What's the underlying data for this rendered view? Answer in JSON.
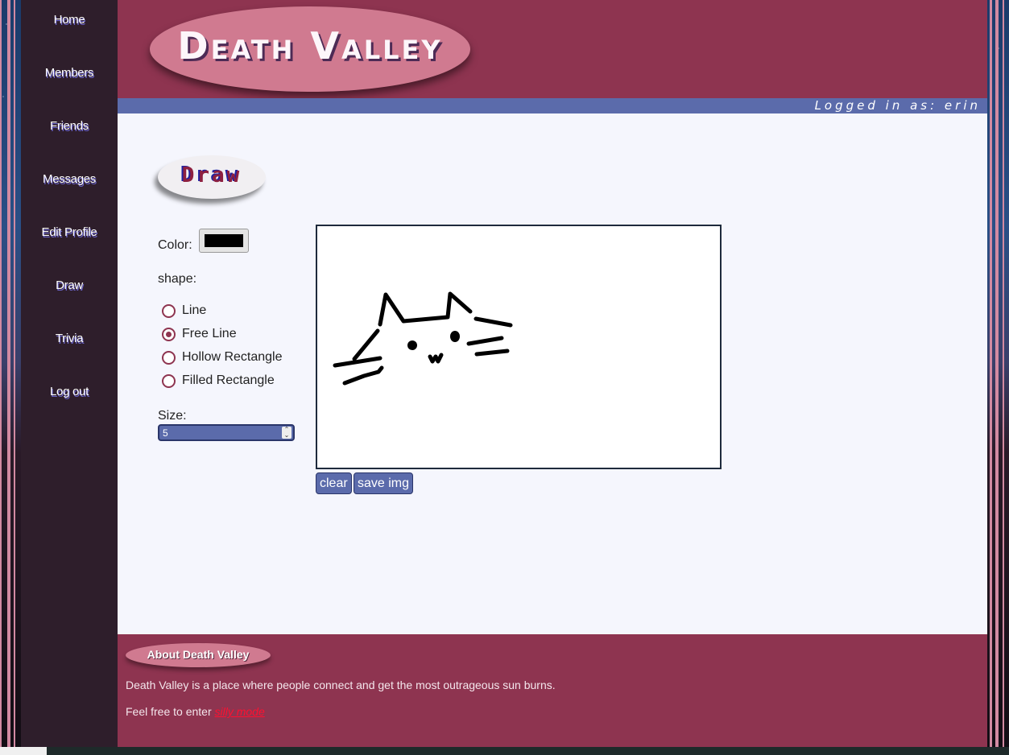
{
  "sidebar": {
    "items": [
      {
        "label": "Home"
      },
      {
        "label": "Members"
      },
      {
        "label": "Friends"
      },
      {
        "label": "Messages"
      },
      {
        "label": "Edit Profile"
      },
      {
        "label": "Draw"
      },
      {
        "label": "Trivia"
      },
      {
        "label": "Log out"
      }
    ]
  },
  "header": {
    "site_title": "Death Valley",
    "logged_in_text": "Logged in as: erin"
  },
  "main": {
    "page_title": "Draw",
    "color_label": "Color:",
    "color_value": "#000000",
    "shape_label": "shape:",
    "shapes": [
      {
        "label": "Line",
        "checked": false
      },
      {
        "label": "Free Line",
        "checked": true
      },
      {
        "label": "Hollow Rectangle",
        "checked": false
      },
      {
        "label": "Filled Rectangle",
        "checked": false
      }
    ],
    "size_label": "Size:",
    "size_value": "5",
    "clear_label": "clear",
    "save_label": "save img"
  },
  "footer": {
    "about_title": "About Death Valley",
    "description": "Death Valley is a place where people connect and get the most outrageous sun burns.",
    "enter_prefix": "Feel free to enter ",
    "silly_link": "silly mode"
  },
  "colors": {
    "brand": "#8e3450",
    "accent": "#5b6bab",
    "sidebar": "#2e1e2b",
    "logo_oval": "#d07a90"
  }
}
